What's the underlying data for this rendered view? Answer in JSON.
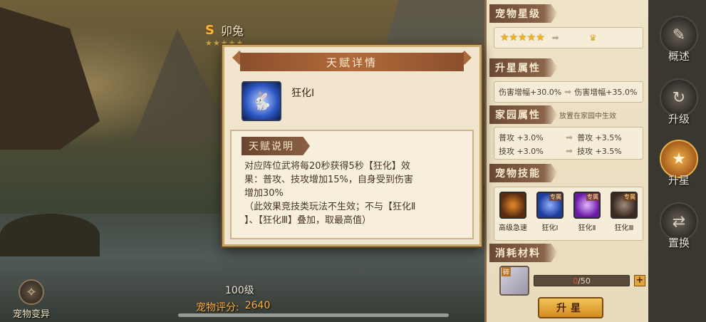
{
  "pet": {
    "rank": "S",
    "name": "卯兔",
    "stars": "★★★★★",
    "level": "100级",
    "score_label": "宠物评分:",
    "score_value": "2640",
    "variant_label": "宠物变异"
  },
  "dialog": {
    "title": "天赋详情",
    "talent_name": "狂化Ⅰ",
    "desc_label": "天赋说明",
    "desc_lines": [
      "对应阵位武将每20秒获得5秒【狂化】效",
      "果：普攻、技攻增加15%，自身受到伤害",
      "增加30%",
      "（此效果竞技类玩法不生效；不与【狂化Ⅱ",
      "】、【狂化Ⅲ】叠加，取最高值）"
    ]
  },
  "panel": {
    "star_level": {
      "title": "宠物星级",
      "current_stars": "★★★★★",
      "arrow": "➡",
      "next": "♛"
    },
    "upgrade_attr": {
      "title": "升星属性",
      "current": "伤害增幅+30.0%",
      "arrow": "➡",
      "next": "伤害增幅+35.0%"
    },
    "home_attr": {
      "title": "家园属性",
      "note": "放置在家园中生效",
      "rows": [
        {
          "current": "普攻 +3.0%",
          "arrow": "➡",
          "next": "普攻 +3.5%"
        },
        {
          "current": "技攻 +3.0%",
          "arrow": "➡",
          "next": "技攻 +3.5%"
        }
      ]
    },
    "skills": {
      "title": "宠物技能",
      "items": [
        {
          "label": "高级急速",
          "tag": ""
        },
        {
          "label": "狂化Ⅰ",
          "tag": "专属"
        },
        {
          "label": "狂化Ⅱ",
          "tag": "专属"
        },
        {
          "label": "狂化Ⅲ",
          "tag": "专属"
        }
      ]
    },
    "materials": {
      "title": "消耗材料",
      "badge": "碎",
      "current": "0",
      "required": "/50",
      "plus": "+"
    },
    "upstar_button": "升星"
  },
  "tabs": [
    {
      "label": "概述",
      "icon": "✎"
    },
    {
      "label": "升级",
      "icon": "↻"
    },
    {
      "label": "升星",
      "icon": "★"
    },
    {
      "label": "置换",
      "icon": "⇄"
    }
  ]
}
